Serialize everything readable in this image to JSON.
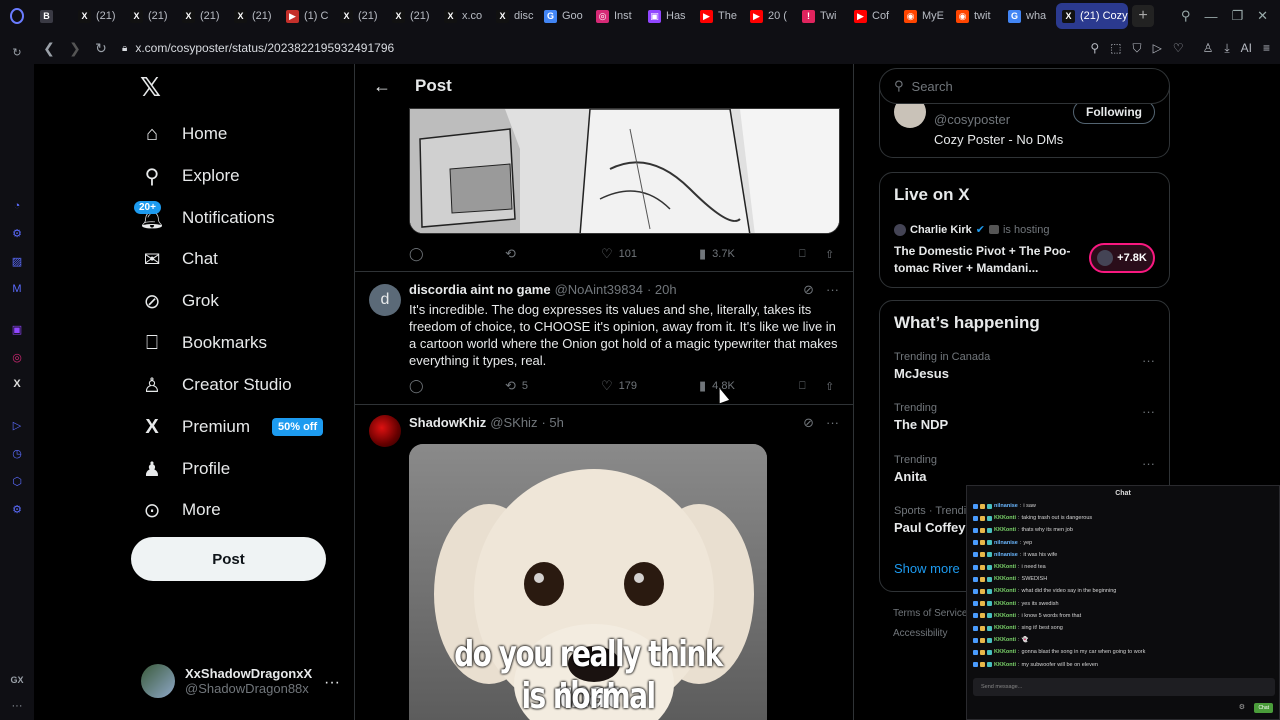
{
  "browser": {
    "tabs": [
      {
        "label": "",
        "fav": "B",
        "color": "#3a3a44"
      },
      {
        "label": "(21)",
        "fav": "X",
        "color": "#111"
      },
      {
        "label": "(21)",
        "fav": "X",
        "color": "#111"
      },
      {
        "label": "(21)",
        "fav": "X",
        "color": "#111"
      },
      {
        "label": "(21)",
        "fav": "X",
        "color": "#111"
      },
      {
        "label": "(1) C",
        "fav": "▶",
        "color": "#c4302b"
      },
      {
        "label": "(21)",
        "fav": "X",
        "color": "#111"
      },
      {
        "label": "(21)",
        "fav": "X",
        "color": "#111"
      },
      {
        "label": "x.co",
        "fav": "X",
        "color": "#111"
      },
      {
        "label": "disc",
        "fav": "X",
        "color": "#111"
      },
      {
        "label": "Goo",
        "fav": "G",
        "color": "#4285f4"
      },
      {
        "label": "Inst",
        "fav": "◎",
        "color": "#d62976"
      },
      {
        "label": "Has",
        "fav": "▣",
        "color": "#9146ff"
      },
      {
        "label": "The",
        "fav": "▶",
        "color": "#ff0000"
      },
      {
        "label": "20 (",
        "fav": "▶",
        "color": "#ff0000"
      },
      {
        "label": "Twi",
        "fav": "!",
        "color": "#e0245e"
      },
      {
        "label": "Cof",
        "fav": "▶",
        "color": "#ff0000"
      },
      {
        "label": "MyE",
        "fav": "◉",
        "color": "#ff4500"
      },
      {
        "label": "twit",
        "fav": "◉",
        "color": "#ff4500"
      },
      {
        "label": "wha",
        "fav": "G",
        "color": "#4285f4"
      }
    ],
    "active_tab": "(21) Cozy",
    "url": "x.com/cosyposter/status/2023822195932491796",
    "ai_label": "AI"
  },
  "nav": {
    "items": [
      {
        "label": "Home",
        "icon": "⌂",
        "name": "home"
      },
      {
        "label": "Explore",
        "icon": "⚲",
        "name": "explore"
      },
      {
        "label": "Notifications",
        "icon": "🔔︎",
        "name": "notifications"
      },
      {
        "label": "Chat",
        "icon": "✉",
        "name": "chat"
      },
      {
        "label": "Grok",
        "icon": "⊘",
        "name": "grok"
      },
      {
        "label": "Bookmarks",
        "icon": "⎕",
        "name": "bookmarks"
      },
      {
        "label": "Creator Studio",
        "icon": "♙",
        "name": "creator-studio"
      },
      {
        "label": "Premium",
        "icon": "X",
        "name": "premium"
      },
      {
        "label": "Profile",
        "icon": "♟",
        "name": "profile"
      },
      {
        "label": "More",
        "icon": "⊙",
        "name": "more"
      }
    ],
    "notif_badge": "20+",
    "premium_badge": "50% off",
    "post_button": "Post",
    "account": {
      "name": "XxShadowDragonxX",
      "handle": "@ShadowDragon88x",
      "more": "···"
    }
  },
  "main": {
    "header_title": "Post",
    "tweet1_actions": {
      "reply": "",
      "retweet": "",
      "likes": "101",
      "views": "3.7K"
    },
    "tweet2": {
      "avatar_letter": "d",
      "name": "discordia aint no game",
      "handle": "@NoAint39834",
      "time": "· 20h",
      "text": "It's incredible. The dog expresses its values and she, literally, takes its freedom of choice, to CHOOSE it's opinion, away from it. It's like we live in a cartoon world where the Onion got hold of a magic typewriter that makes everything it types, real.",
      "retweets": "5",
      "likes": "179",
      "views": "4.8K"
    },
    "tweet3": {
      "name": "ShadowKhiz",
      "handle": "@SKhiz",
      "time": "· 5h",
      "caption_line1": "do you really think that",
      "caption_line2": "is normal"
    }
  },
  "right": {
    "search_placeholder": "Search",
    "profile_card": {
      "handle": "@cosyposter",
      "bio": "Cozy Poster - No DMs",
      "follow": "Following"
    },
    "live": {
      "title": "Live on X",
      "host": "Charlie Kirk",
      "hosting": "is hosting",
      "show": "The Domestic Pivot + The Poo-tomac River + Mamdani...",
      "count": "+7.8K"
    },
    "happening": {
      "title": "What’s happening",
      "trends": [
        {
          "ctx": "Trending in Canada",
          "name": "McJesus"
        },
        {
          "ctx": "Trending",
          "name": "The NDP"
        },
        {
          "ctx": "Trending",
          "name": "Anita"
        },
        {
          "ctx": "Sports · Trendi",
          "name": "Paul Coffey"
        }
      ],
      "show_more": "Show more"
    },
    "footer": {
      "terms": "Terms of Service",
      "accessibility": "Accessibility"
    }
  },
  "chat": {
    "title": "Chat",
    "lines": [
      {
        "user": "nilnanise",
        "color": "#6ab7ff",
        "msg": "i saw"
      },
      {
        "user": "KKKonti",
        "color": "#7cd66b",
        "msg": "taking trash out is dangerous"
      },
      {
        "user": "KKKonti",
        "color": "#7cd66b",
        "msg": "thats why its men job"
      },
      {
        "user": "nilnanise",
        "color": "#6ab7ff",
        "msg": "yep"
      },
      {
        "user": "nilnanise",
        "color": "#6ab7ff",
        "msg": "it was his wife"
      },
      {
        "user": "KKKonti",
        "color": "#7cd66b",
        "msg": "i need tea"
      },
      {
        "user": "KKKonti",
        "color": "#7cd66b",
        "msg": "SWEDISH"
      },
      {
        "user": "KKKonti",
        "color": "#7cd66b",
        "msg": "what did the video say in the beginning"
      },
      {
        "user": "KKKonti",
        "color": "#7cd66b",
        "msg": "yes its swedish"
      },
      {
        "user": "KKKonti",
        "color": "#7cd66b",
        "msg": "i know 5 words from that"
      },
      {
        "user": "KKKonti",
        "color": "#7cd66b",
        "msg": "sing it! best song"
      },
      {
        "user": "KKKonti",
        "color": "#7cd66b",
        "msg": "👻"
      },
      {
        "user": "KKKonti",
        "color": "#7cd66b",
        "msg": "gonna blast the song in my car when going to work"
      },
      {
        "user": "KKKonti",
        "color": "#7cd66b",
        "msg": "my subwoofer will be on eleven"
      }
    ],
    "input_placeholder": "Send message...",
    "send": "Chat"
  }
}
